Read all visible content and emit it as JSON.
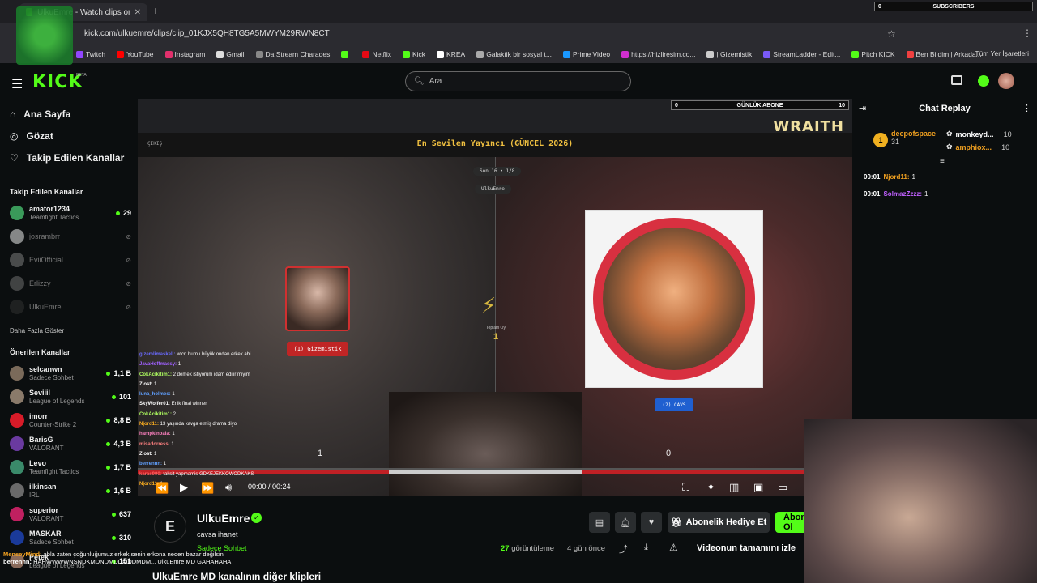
{
  "browser": {
    "tab_title": "UlkuEmre - Watch clips on Kick",
    "url": "kick.com/ulkuemre/clips/clip_01KJX5QH8TG5A5MWYM29RWN8CT",
    "bookmarks": [
      {
        "label": "Twitch",
        "color": "#9146ff"
      },
      {
        "label": "YouTube",
        "color": "#ff0000"
      },
      {
        "label": "Instagram",
        "color": "#e1306c"
      },
      {
        "label": "Gmail",
        "color": "#dddddd"
      },
      {
        "label": "Da Stream Charades",
        "color": "#888888"
      },
      {
        "label": "",
        "color": "#53fc18"
      },
      {
        "label": "Netflix",
        "color": "#e50914"
      },
      {
        "label": "Kick",
        "color": "#53fc18"
      },
      {
        "label": "KREA",
        "color": "#ffffff"
      },
      {
        "label": "Galaktik bir sosyal t...",
        "color": "#aaaaaa"
      },
      {
        "label": "Prime Video",
        "color": "#1a98ff"
      },
      {
        "label": "https://hizliresim.co...",
        "color": "#d02fd0"
      },
      {
        "label": "| Gizemistik",
        "color": "#cccccc"
      },
      {
        "label": "StreamLadder - Edit...",
        "color": "#7a5af8"
      },
      {
        "label": "Pitch KICK",
        "color": "#53fc18"
      },
      {
        "label": "Ben Bildim | Arkada...",
        "color": "#f04040"
      }
    ],
    "bookmarks_right": "Tüm Yer İşaretleri"
  },
  "overlay": {
    "subs_count": "0",
    "subs_label": "SUBSCRIBERS"
  },
  "kick": {
    "logo": "KICK",
    "beta": "BETA",
    "search_placeholder": "Ara"
  },
  "sidebar": {
    "nav": [
      {
        "label": "Ana Sayfa",
        "icon": "home-icon"
      },
      {
        "label": "Gözat",
        "icon": "compass-icon"
      },
      {
        "label": "Takip Edilen Kanallar",
        "icon": "heart-icon"
      }
    ],
    "followed_heading": "Takip Edilen Kanallar",
    "followed": [
      {
        "name": "amator1234",
        "category": "Teamfight Tactics",
        "viewers": "29",
        "live": true,
        "color": "#3a9a5a"
      },
      {
        "name": "josrambrr",
        "category": "",
        "viewers": "",
        "live": false,
        "color": "#ffffff"
      },
      {
        "name": "EviiOfficial",
        "category": "",
        "viewers": "",
        "live": false,
        "color": "#888888"
      },
      {
        "name": "Erlizzy",
        "category": "",
        "viewers": "",
        "live": false,
        "color": "#777777"
      },
      {
        "name": "UlkuEmre",
        "category": "",
        "viewers": "",
        "live": false,
        "color": "#333333"
      }
    ],
    "show_more": "Daha Fazla Göster",
    "recommended_heading": "Önerilen Kanallar",
    "recommended": [
      {
        "name": "selcanwn",
        "category": "Sadece Sohbet",
        "viewers": "1,1 B",
        "color": "#7a6a5a"
      },
      {
        "name": "Seviiil",
        "category": "League of Legends",
        "viewers": "101",
        "color": "#8a7a6a"
      },
      {
        "name": "imorr",
        "category": "Counter-Strike 2",
        "viewers": "8,8 B",
        "color": "#d81b28"
      },
      {
        "name": "BarisG",
        "category": "VALORANT",
        "viewers": "4,3 B",
        "color": "#6a3aa0"
      },
      {
        "name": "Levo",
        "category": "Teamfight Tactics",
        "viewers": "1,7 B",
        "color": "#3a8a6a"
      },
      {
        "name": "ilkinsan",
        "category": "IRL",
        "viewers": "1,6 B",
        "color": "#6a6a6a"
      },
      {
        "name": "superior",
        "category": "VALORANT",
        "viewers": "637",
        "color": "#c02060"
      },
      {
        "name": "MASKAR",
        "category": "Sadece Sohbet",
        "viewers": "310",
        "color": "#1a3a9a"
      },
      {
        "name": "Petek",
        "category": "League of Legends",
        "viewers": "151",
        "color": "#8a6a5a"
      }
    ]
  },
  "stream": {
    "inner_title": "En Sevilen Yayıncı (GÜNCEL 2026)",
    "back": "ÇIKIŞ",
    "wraith": "WRAITH",
    "gunluk_count": "0",
    "gunluk_label": "GÜNLÜK ABONE",
    "gunluk_right": "10",
    "round": "Son 16 • 1/8",
    "owner": "UlkuEmre",
    "left_label": "(1) Gizemistik",
    "right_label": "(2) CAVS",
    "total_label": "Toplam Oy",
    "total_value": "1",
    "score_left": "1",
    "score_right": "0",
    "chat_overlay": [
      {
        "user": "gizemlimaskeli:",
        "text": " wtcn burnu büyük ondan erkek abi",
        "color": "#6a6aff"
      },
      {
        "user": "JavaHoffmassy:",
        "text": " 1",
        "color": "#a060ff"
      },
      {
        "user": "CokAcikitim1:",
        "text": " 2 demek istiyorum idam edilir miyim",
        "color": "#b0ff60"
      },
      {
        "user": "Ziost:",
        "text": " 1",
        "color": "#ffffff"
      },
      {
        "user": "luna_holmes:",
        "text": " 1",
        "color": "#60a0ff"
      },
      {
        "user": "SkyWolfer01:",
        "text": " Erlik final winner",
        "color": "#ffffff"
      },
      {
        "user": "CokAcikitim1:",
        "text": " 2",
        "color": "#b0ff60"
      },
      {
        "user": "Njord11:",
        "text": " 13 yaşında kavga etmiş drama diyo",
        "color": "#ffb020"
      },
      {
        "user": "hampkinoala:",
        "text": " 1",
        "color": "#ff80c0"
      },
      {
        "user": "misadorress:",
        "text": " 1",
        "color": "#ff8080"
      },
      {
        "user": "Ziost:",
        "text": " 1",
        "color": "#ffffff"
      },
      {
        "user": "berrennn:",
        "text": " 1",
        "color": "#60a0ff"
      },
      {
        "user": "karas990:",
        "text": " taksit yapmamis GDKEJEKKOWODKAKS",
        "color": "#ff6060"
      },
      {
        "user": "Njord11:",
        "text": " 1",
        "color": "#ffb020"
      }
    ],
    "time": "00:00 / 00:24",
    "progress": 0
  },
  "clip": {
    "channel": "UlkuEmre",
    "title": "cavsa ihanet",
    "category": "Sadece Sohbet",
    "gift_label": "Abonelik Hediye Et",
    "subscribe_label": "Abone Ol",
    "views_count": "27",
    "views_label": "görüntüleme",
    "ago": "4 gün önce",
    "full_video": "Videonun tamamını izle",
    "more_clips": "UlkuEmre MD kanalının diğer klipleri"
  },
  "chat": {
    "title": "Chat Replay",
    "leaders": [
      {
        "name": "deepofspace",
        "sub": "31",
        "color": "#f0a020"
      },
      {
        "name": "monkeyd...",
        "sub": "10",
        "color": "#ffffff"
      },
      {
        "name": "amphiox...",
        "sub": "10",
        "color": "#f0a020"
      }
    ],
    "messages": [
      {
        "time": "00:01",
        "user": "Njord11:",
        "text": "1",
        "color": "#f0a020"
      },
      {
        "time": "00:01",
        "user": "SolmazZzzz:",
        "text": "1",
        "color": "#c060ff"
      }
    ]
  },
  "bottom_overlay_chat": [
    {
      "user": "MenseyMind:",
      "text": " abla zaten çoğunluğumuz erkek senin erkona neden bazar değilsin",
      "cls": "u1"
    },
    {
      "user": "berrennn:",
      "text": " HAHWWWWNSNDKMDNDMDDMDDMDM... UlkuEmre MD GAHAHAHA",
      "cls": "u2"
    }
  ]
}
